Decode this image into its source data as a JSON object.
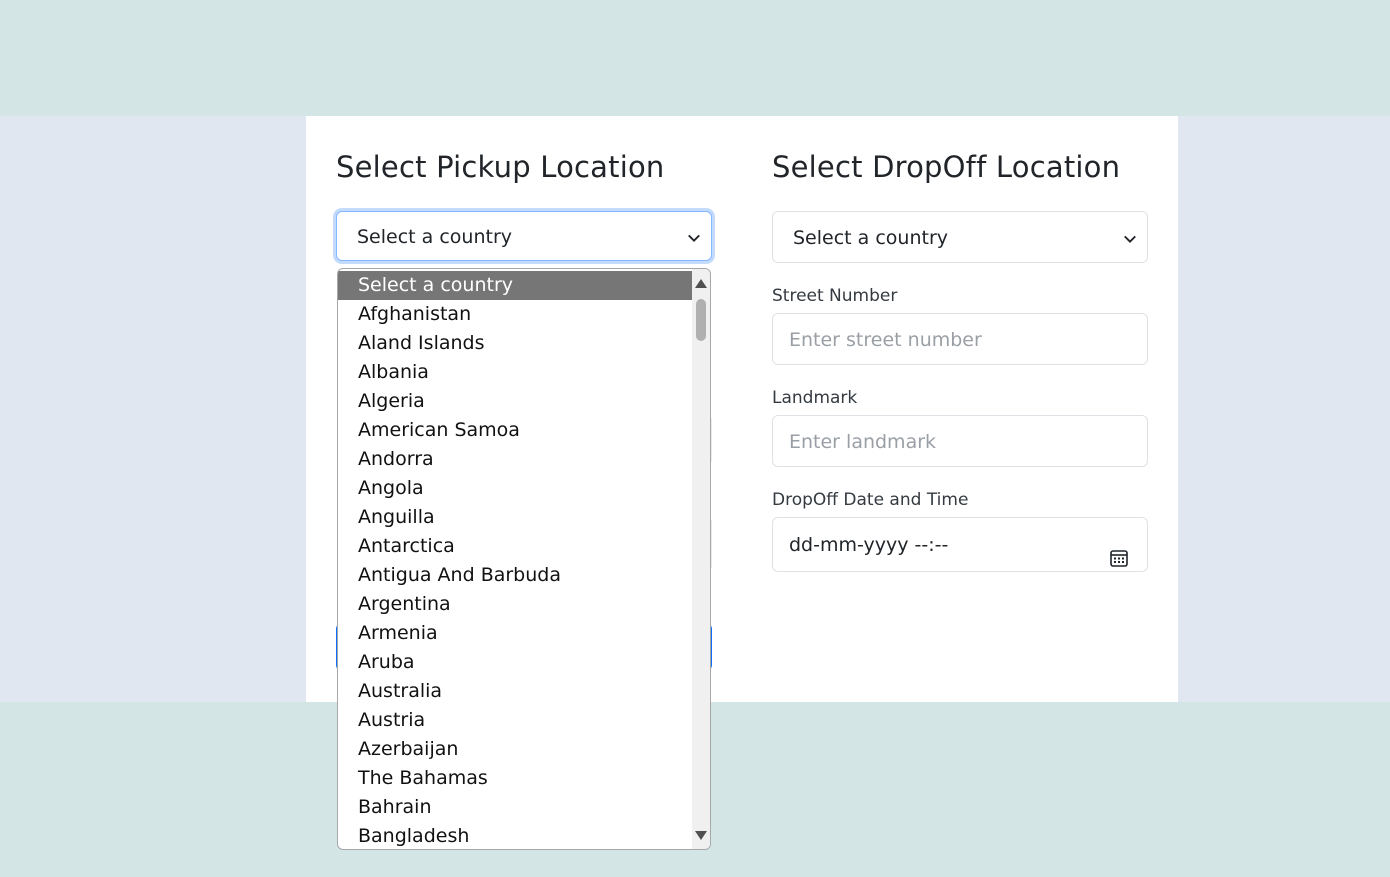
{
  "pickup": {
    "title": "Select Pickup Location",
    "country_select": {
      "value": "Select a country"
    }
  },
  "dropoff": {
    "title": "Select DropOff Location",
    "country_select": {
      "value": "Select a country"
    },
    "street_number": {
      "label": "Street Number",
      "placeholder": "Enter street number"
    },
    "landmark": {
      "label": "Landmark",
      "placeholder": "Enter landmark"
    },
    "datetime": {
      "label": "DropOff Date and Time",
      "value": "dd-mm-yyyy --:--"
    }
  },
  "country_dropdown": {
    "selected": "Select a country",
    "options": [
      "Select a country",
      "Afghanistan",
      "Aland Islands",
      "Albania",
      "Algeria",
      "American Samoa",
      "Andorra",
      "Angola",
      "Anguilla",
      "Antarctica",
      "Antigua And Barbuda",
      "Argentina",
      "Armenia",
      "Aruba",
      "Australia",
      "Austria",
      "Azerbaijan",
      "The Bahamas",
      "Bahrain",
      "Bangladesh"
    ]
  },
  "colors": {
    "page_bg": "#d4e5e5",
    "band_bg": "#e0e7f0",
    "card_bg": "#ffffff",
    "focus_ring": "#86b7fe",
    "selected_option_bg": "#767676"
  }
}
